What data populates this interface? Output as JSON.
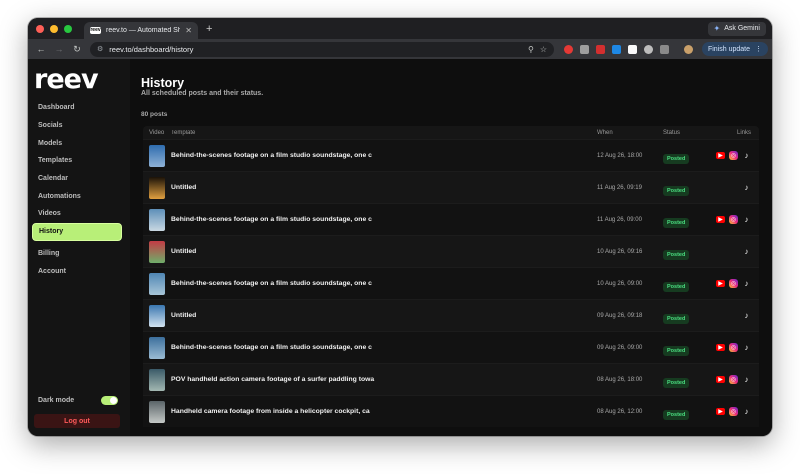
{
  "browser": {
    "tab_title": "reev.to — Automated Shorts",
    "favicon_text": "reev",
    "new_tab": "+",
    "gemini_label": "Ask Gemini",
    "url": "reev.to/dashboard/history",
    "finish_update": "Finish update"
  },
  "sidebar": {
    "logo": "reev",
    "items": [
      {
        "label": "Dashboard"
      },
      {
        "label": "Socials"
      },
      {
        "label": "Models"
      },
      {
        "label": "Templates"
      },
      {
        "label": "Calendar"
      },
      {
        "label": "Automations"
      },
      {
        "label": "Videos"
      },
      {
        "label": "History"
      }
    ],
    "items2": [
      {
        "label": "Billing"
      },
      {
        "label": "Account"
      }
    ],
    "dark_mode_label": "Dark mode",
    "logout_label": "Log out"
  },
  "main": {
    "title": "History",
    "subtitle": "All scheduled posts and their status.",
    "count": "80 posts",
    "columns": {
      "video": "Video",
      "template": "Template",
      "when": "When",
      "status": "Status",
      "links": "Links"
    },
    "rows": [
      {
        "template": "Behind-the-scenes footage on a film studio soundstage, one c",
        "when": "12 Aug 26, 18:00",
        "status": "Posted",
        "thumb": [
          "#2e6cae",
          "#8fb2d6"
        ],
        "links": [
          "youtube",
          "instagram",
          "tiktok"
        ]
      },
      {
        "template": "Untitled",
        "when": "11 Aug 26, 09:19",
        "status": "Posted",
        "thumb": [
          "#1a1208",
          "#e0a040"
        ],
        "links": [
          "tiktok"
        ]
      },
      {
        "template": "Behind-the-scenes footage on a film studio soundstage, one c",
        "when": "11 Aug 26, 09:00",
        "status": "Posted",
        "thumb": [
          "#5d8fb8",
          "#c9d8e2"
        ],
        "links": [
          "youtube",
          "instagram",
          "tiktok"
        ]
      },
      {
        "template": "Untitled",
        "when": "10 Aug 26, 09:16",
        "status": "Posted",
        "thumb": [
          "#c43b45",
          "#6fae6a"
        ],
        "links": [
          "tiktok"
        ]
      },
      {
        "template": "Behind-the-scenes footage on a film studio soundstage, one c",
        "when": "10 Aug 26, 09:00",
        "status": "Posted",
        "thumb": [
          "#4f86b4",
          "#a8c6d8"
        ],
        "links": [
          "youtube",
          "instagram",
          "tiktok"
        ]
      },
      {
        "template": "Untitled",
        "when": "09 Aug 26, 09:18",
        "status": "Posted",
        "thumb": [
          "#3a76b0",
          "#d2e2ef"
        ],
        "links": [
          "tiktok"
        ]
      },
      {
        "template": "Behind-the-scenes footage on a film studio soundstage, one c",
        "when": "09 Aug 26, 09:00",
        "status": "Posted",
        "thumb": [
          "#3c6f9c",
          "#9bbcd4"
        ],
        "links": [
          "youtube",
          "instagram",
          "tiktok"
        ]
      },
      {
        "template": "POV handheld action camera footage of a surfer paddling towa",
        "when": "08 Aug 26, 18:00",
        "status": "Posted",
        "thumb": [
          "#3a5a68",
          "#a3b8b2"
        ],
        "links": [
          "youtube",
          "instagram",
          "tiktok"
        ]
      },
      {
        "template": "Handheld camera footage from inside a helicopter cockpit, ca",
        "when": "08 Aug 26, 12:00",
        "status": "Posted",
        "thumb": [
          "#5a6468",
          "#c4c8c6"
        ],
        "links": [
          "youtube",
          "instagram",
          "tiktok"
        ]
      }
    ]
  },
  "colors": {
    "accent": "#b8ef78",
    "posted": "#4ade80",
    "logout": "#ff5a5a"
  }
}
